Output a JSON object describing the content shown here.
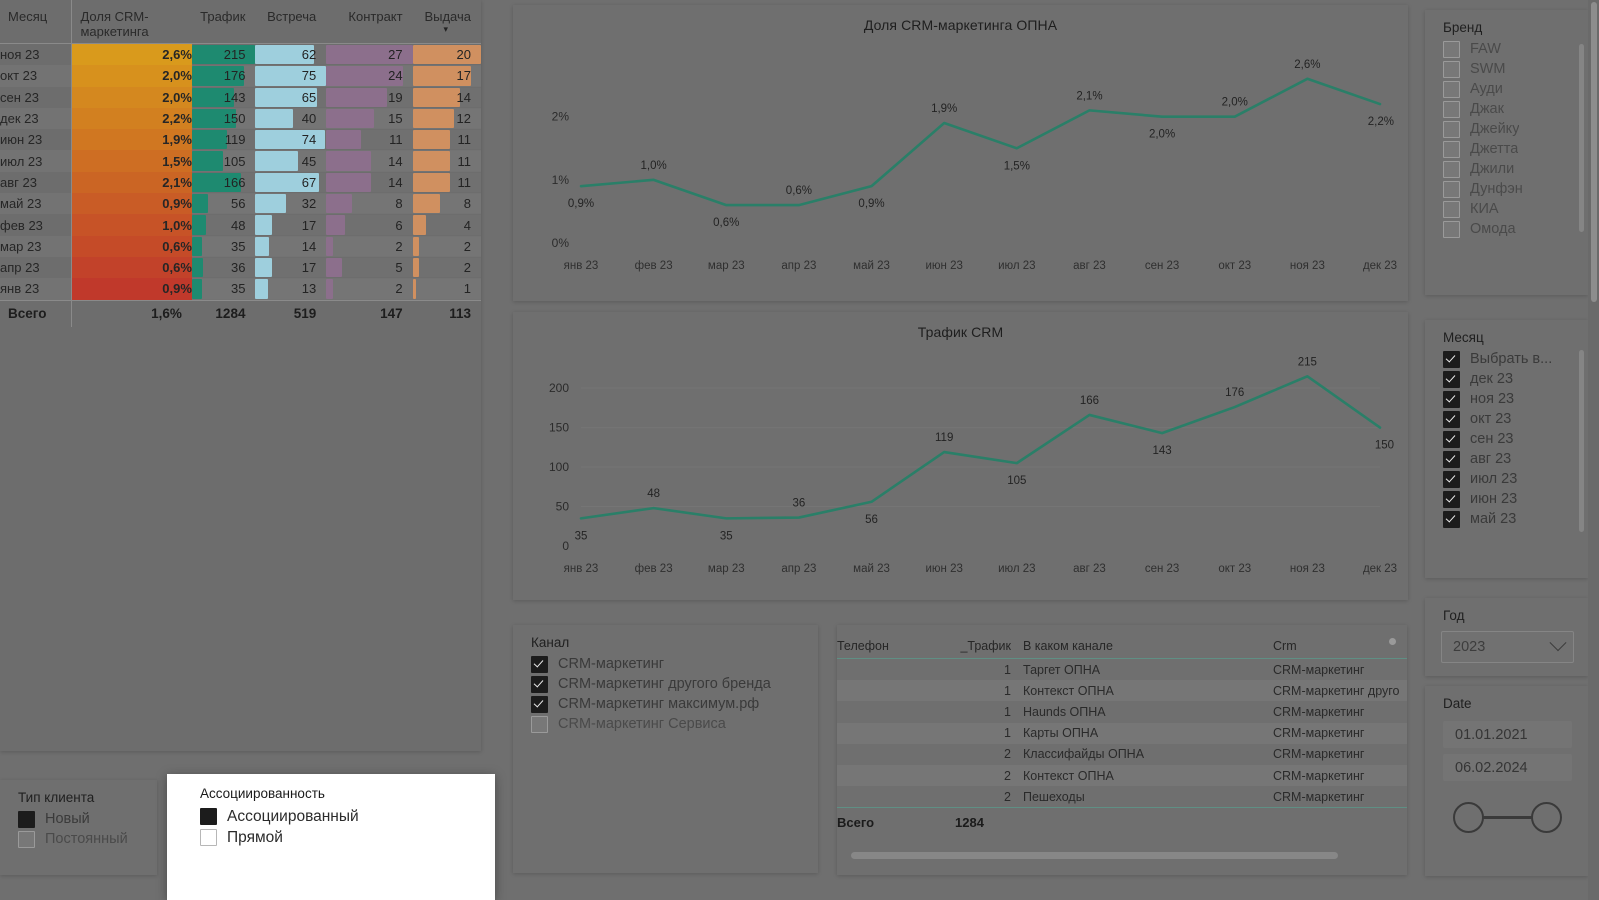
{
  "matrix": {
    "name": "CRM marketing funnel matrix",
    "columns": [
      "Месяц",
      "Доля CRM-маркетинга",
      "Трафик",
      "Встреча",
      "Контракт",
      "Выдача"
    ],
    "rows": [
      {
        "month": "ноя 23",
        "share": "2,6%",
        "traffic": 215,
        "meeting": 62,
        "contract": 27,
        "delivery": 20
      },
      {
        "month": "окт 23",
        "share": "2,0%",
        "traffic": 176,
        "meeting": 75,
        "contract": 24,
        "delivery": 17
      },
      {
        "month": "сен 23",
        "share": "2,0%",
        "traffic": 143,
        "meeting": 65,
        "contract": 19,
        "delivery": 14
      },
      {
        "month": "дек 23",
        "share": "2,2%",
        "traffic": 150,
        "meeting": 40,
        "contract": 15,
        "delivery": 12
      },
      {
        "month": "июн 23",
        "share": "1,9%",
        "traffic": 119,
        "meeting": 74,
        "contract": 11,
        "delivery": 11
      },
      {
        "month": "июл 23",
        "share": "1,5%",
        "traffic": 105,
        "meeting": 45,
        "contract": 14,
        "delivery": 11
      },
      {
        "month": "авг 23",
        "share": "2,1%",
        "traffic": 166,
        "meeting": 67,
        "contract": 14,
        "delivery": 11
      },
      {
        "month": "май 23",
        "share": "0,9%",
        "traffic": 56,
        "meeting": 32,
        "contract": 8,
        "delivery": 8
      },
      {
        "month": "фев 23",
        "share": "1,0%",
        "traffic": 48,
        "meeting": 17,
        "contract": 6,
        "delivery": 4
      },
      {
        "month": "мар 23",
        "share": "0,6%",
        "traffic": 35,
        "meeting": 14,
        "contract": 2,
        "delivery": 2
      },
      {
        "month": "апр 23",
        "share": "0,6%",
        "traffic": 36,
        "meeting": 17,
        "contract": 5,
        "delivery": 2
      },
      {
        "month": "янв 23",
        "share": "0,9%",
        "traffic": 35,
        "meeting": 13,
        "contract": 2,
        "delivery": 1
      }
    ],
    "total": {
      "label": "Всего",
      "share": "1,6%",
      "traffic": 1284,
      "meeting": 519,
      "contract": 147,
      "delivery": 113
    },
    "colors": {
      "heat_high": "#d99a1c",
      "heat_low": "#c0392b",
      "traffic_bar": "#1e8a70",
      "meeting_bar": "#9ecfdd",
      "contract_bar": "#8c6f8c",
      "delivery_bar": "#d09060"
    }
  },
  "chart_data": [
    {
      "type": "line",
      "name": "share-chart",
      "title": "Доля CRM-маркетинга ОПНА",
      "xlabel": "",
      "ylabel": "",
      "categories": [
        "янв 23",
        "фев 23",
        "мар 23",
        "апр 23",
        "май 23",
        "июн 23",
        "июл 23",
        "авг 23",
        "сен 23",
        "окт 23",
        "ноя 23",
        "дек 23"
      ],
      "values": [
        0.9,
        1.0,
        0.6,
        0.6,
        0.9,
        1.9,
        1.5,
        2.1,
        2.0,
        2.0,
        2.6,
        2.2
      ],
      "data_labels": [
        "0,9%",
        "1,0%",
        "0,6%",
        "0,6%",
        "0,9%",
        "1,9%",
        "1,5%",
        "2,1%",
        "2,0%",
        "2,0%",
        "2,6%",
        "2,2%"
      ],
      "ytick_labels": [
        "0%",
        "1%",
        "2%"
      ],
      "yticks": [
        0,
        1,
        2
      ],
      "ylim": [
        0,
        2.85
      ],
      "grid": false,
      "legend": "none",
      "line_color": "#2a7f68"
    },
    {
      "type": "line",
      "name": "traffic-chart",
      "title": "Трафик CRM",
      "xlabel": "",
      "ylabel": "",
      "categories": [
        "янв 23",
        "фев 23",
        "мар 23",
        "апр 23",
        "май 23",
        "июн 23",
        "июл 23",
        "авг 23",
        "сен 23",
        "окт 23",
        "ноя 23",
        "дек 23"
      ],
      "values": [
        35,
        48,
        35,
        36,
        56,
        119,
        105,
        166,
        143,
        176,
        215,
        150
      ],
      "data_labels": [
        "35",
        "48",
        "35",
        "36",
        "56",
        "119",
        "105",
        "166",
        "143",
        "176",
        "215",
        "150"
      ],
      "ytick_labels": [
        "0",
        "50",
        "100",
        "150",
        "200"
      ],
      "yticks": [
        0,
        50,
        100,
        150,
        200
      ],
      "ylim": [
        0,
        228
      ],
      "grid": true,
      "legend": "none",
      "line_color": "#2a7f68"
    }
  ],
  "brand_slicer": {
    "title": "Бренд",
    "items": [
      {
        "label": "FAW",
        "checked": false
      },
      {
        "label": "SWM",
        "checked": false
      },
      {
        "label": "Ауди",
        "checked": false
      },
      {
        "label": "Джак",
        "checked": false
      },
      {
        "label": "Джейку",
        "checked": false
      },
      {
        "label": "Джетта",
        "checked": false
      },
      {
        "label": "Джили",
        "checked": false
      },
      {
        "label": "Дунфэн",
        "checked": false
      },
      {
        "label": "КИА",
        "checked": false
      },
      {
        "label": "Омода",
        "checked": false
      }
    ]
  },
  "month_slicer": {
    "title": "Месяц",
    "items": [
      {
        "label": "Выбрать в...",
        "checked": true
      },
      {
        "label": "дек 23",
        "checked": true
      },
      {
        "label": "ноя 23",
        "checked": true
      },
      {
        "label": "окт 23",
        "checked": true
      },
      {
        "label": "сен 23",
        "checked": true
      },
      {
        "label": "авг 23",
        "checked": true
      },
      {
        "label": "июл 23",
        "checked": true
      },
      {
        "label": "июн 23",
        "checked": true
      },
      {
        "label": "май 23",
        "checked": true
      }
    ]
  },
  "year_slicer": {
    "title": "Год",
    "value": "2023"
  },
  "date_slicer": {
    "title": "Date",
    "from": "01.01.2021",
    "to": "06.02.2024"
  },
  "channel_slicer": {
    "title": "Канал",
    "items": [
      {
        "label": "CRM-маркетинг",
        "checked": true
      },
      {
        "label": "CRM-маркетинг другого бренда",
        "checked": true
      },
      {
        "label": "CRM-маркетинг максимум.рф",
        "checked": true
      },
      {
        "label": "CRM-маркетинг Сервиса",
        "checked": false
      }
    ]
  },
  "client_slicer": {
    "title": "Тип клиента",
    "items": [
      {
        "label": "Новый",
        "checked": true
      },
      {
        "label": "Постоянный",
        "checked": false
      }
    ]
  },
  "association_popup": {
    "title": "Ассоциированность",
    "items": [
      {
        "label": "Ассоциированный",
        "checked": true
      },
      {
        "label": "Прямой",
        "checked": false
      }
    ]
  },
  "detail_table": {
    "columns": [
      "Телефон",
      "_Трафик",
      "В каком канале",
      "Crm"
    ],
    "rows": [
      {
        "phone": "",
        "traffic": "1",
        "channel": "Таргет ОПНА",
        "crm": "CRM-маркетинг"
      },
      {
        "phone": "",
        "traffic": "1",
        "channel": "Контекст ОПНА",
        "crm": "CRM-маркетинг друго"
      },
      {
        "phone": "",
        "traffic": "1",
        "channel": "Haunds ОПНА",
        "crm": "CRM-маркетинг"
      },
      {
        "phone": "",
        "traffic": "1",
        "channel": "Карты ОПНА",
        "crm": "CRM-маркетинг"
      },
      {
        "phone": "",
        "traffic": "2",
        "channel": "Классифайды ОПНА",
        "crm": "CRM-маркетинг"
      },
      {
        "phone": "",
        "traffic": "2",
        "channel": "Контекст ОПНА",
        "crm": "CRM-маркетинг"
      },
      {
        "phone": "",
        "traffic": "2",
        "channel": "Пешеходы",
        "crm": "CRM-маркетинг"
      }
    ],
    "total": {
      "label": "Всего",
      "traffic": "1284"
    }
  }
}
